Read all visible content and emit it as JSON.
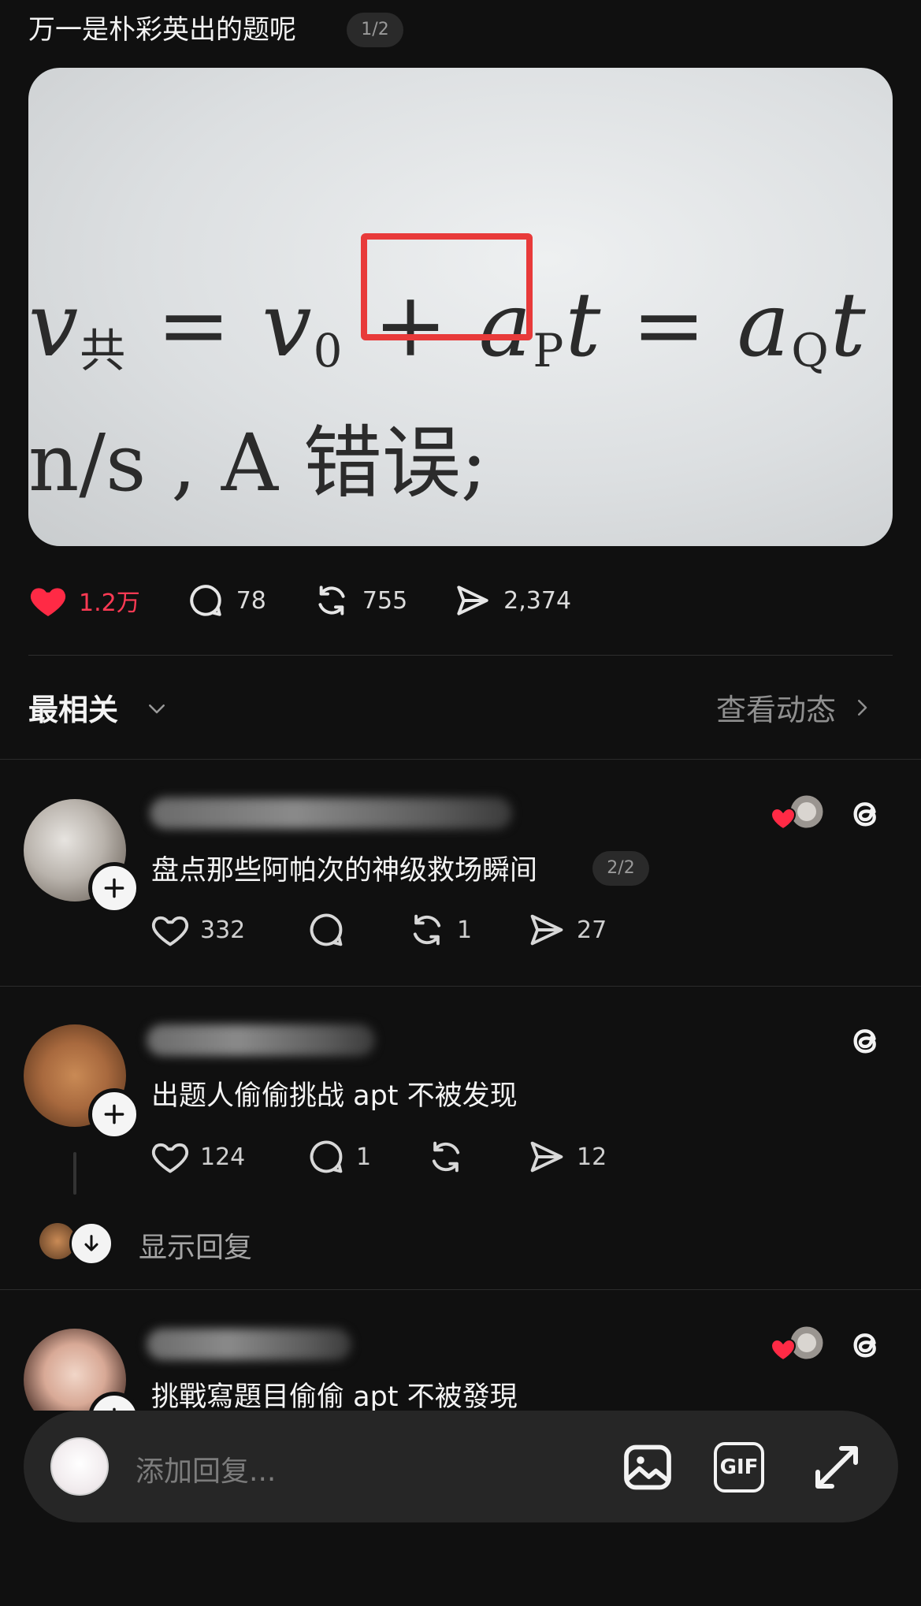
{
  "post": {
    "title": "万一是朴彩英出的题呢",
    "page_indicator": "1/2",
    "image": {
      "formula": "v共 = v0 + aPt = aQt",
      "formula_parts": [
        "v",
        "共",
        " = v",
        "0",
        " + ",
        "a",
        "P",
        "t",
        " = a",
        "Q",
        "t"
      ],
      "line2": "n/s , A 错误;"
    },
    "stats": {
      "likes": "1.2万",
      "comments": "78",
      "reposts": "755",
      "shares": "2,374"
    }
  },
  "sort": {
    "label": "最相关",
    "view_activity": "查看动态"
  },
  "comments": [
    {
      "text": "盘点那些阿帕次的神级救场瞬间",
      "page_indicator": "2/2",
      "likes": "332",
      "comments": "",
      "reposts": "1",
      "shares": "27",
      "author_liked": true
    },
    {
      "text": "出题人偷偷挑战 apt 不被发现",
      "likes": "124",
      "comments": "1",
      "reposts": "",
      "shares": "12",
      "author_liked": false
    },
    {
      "text": "挑戰寫題目偷偷 apt 不被發現",
      "author_liked": true
    }
  ],
  "show_replies": "显示回复",
  "reply_bar": {
    "placeholder": "添加回复...",
    "gif_label": "GIF"
  },
  "colors": {
    "background": "#101010",
    "like_red": "#ff3a54",
    "highlight_box": "#e83a3a"
  }
}
